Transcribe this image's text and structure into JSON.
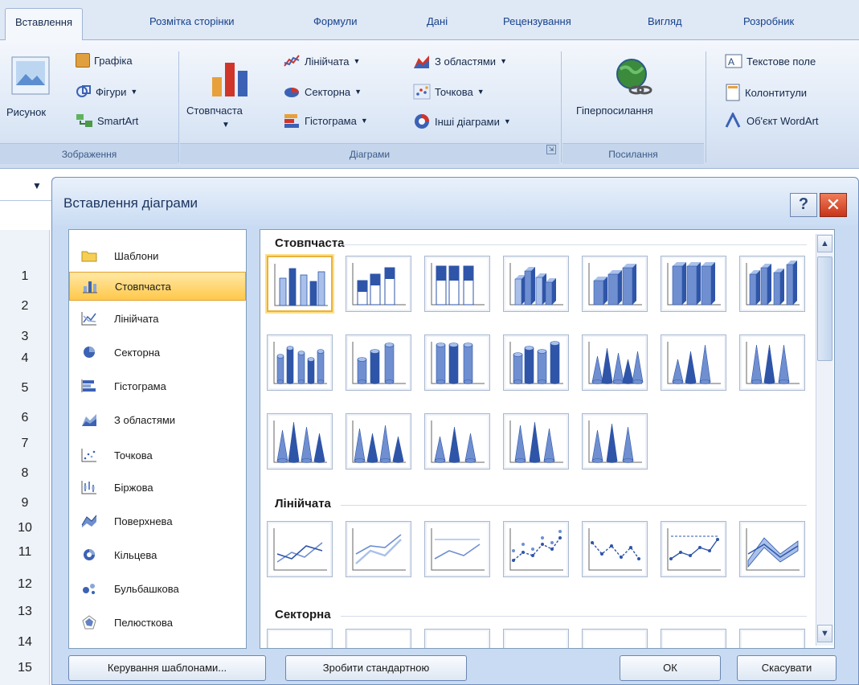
{
  "ribbon": {
    "tabs": [
      "Вставлення",
      "Розмітка сторінки",
      "Формули",
      "Дані",
      "Рецензування",
      "Вигляд",
      "Розробник"
    ],
    "images_group": {
      "label": "Зображення",
      "picture": "Рисунок",
      "graphics": "Графіка",
      "shapes": "Фігури",
      "smartart": "SmartArt"
    },
    "charts_group": {
      "label": "Діаграми",
      "column": "Стовпчаста",
      "line": "Лінійчата",
      "pie": "Секторна",
      "bar": "Гістограма",
      "area": "З областями",
      "scatter": "Точкова",
      "other": "Інші діаграми"
    },
    "links_group": {
      "label": "Посилання",
      "hyperlink": "Гіперпосилання"
    },
    "text_group": {
      "textbox": "Текстове поле",
      "headers": "Колонтитули",
      "wordart": "Об'єкт WordArt"
    }
  },
  "sheet": {
    "row_numbers": [
      "1",
      "2",
      "3",
      "4",
      "5",
      "6",
      "7",
      "8",
      "9",
      "10",
      "11",
      "12",
      "13",
      "14",
      "15"
    ]
  },
  "dialog": {
    "title": "Вставлення діаграми",
    "help": "?",
    "close": "✕",
    "categories": [
      {
        "label": "Шаблони",
        "icon": "folder-icon"
      },
      {
        "label": "Стовпчаста",
        "icon": "column-chart-icon",
        "selected": true
      },
      {
        "label": "Лінійчата",
        "icon": "line-chart-icon"
      },
      {
        "label": "Секторна",
        "icon": "pie-chart-icon"
      },
      {
        "label": "Гістограма",
        "icon": "bar-chart-icon"
      },
      {
        "label": "З областями",
        "icon": "area-chart-icon"
      },
      {
        "label": "Точкова",
        "icon": "scatter-chart-icon"
      },
      {
        "label": "Біржова",
        "icon": "stock-chart-icon"
      },
      {
        "label": "Поверхнева",
        "icon": "surface-chart-icon"
      },
      {
        "label": "Кільцева",
        "icon": "doughnut-chart-icon"
      },
      {
        "label": "Бульбашкова",
        "icon": "bubble-chart-icon"
      },
      {
        "label": "Пелюсткова",
        "icon": "radar-chart-icon"
      }
    ],
    "sections": {
      "column": "Стовпчаста",
      "line": "Лінійчата",
      "pie": "Секторна"
    },
    "buttons": {
      "manage_templates": "Керування шаблонами...",
      "set_default": "Зробити стандартною",
      "ok": "ОК",
      "cancel": "Скасувати"
    }
  },
  "colors": {
    "accent_blue": "#3c62b5",
    "light_blue": "#a9c1ea",
    "selection": "#ffc84a"
  }
}
